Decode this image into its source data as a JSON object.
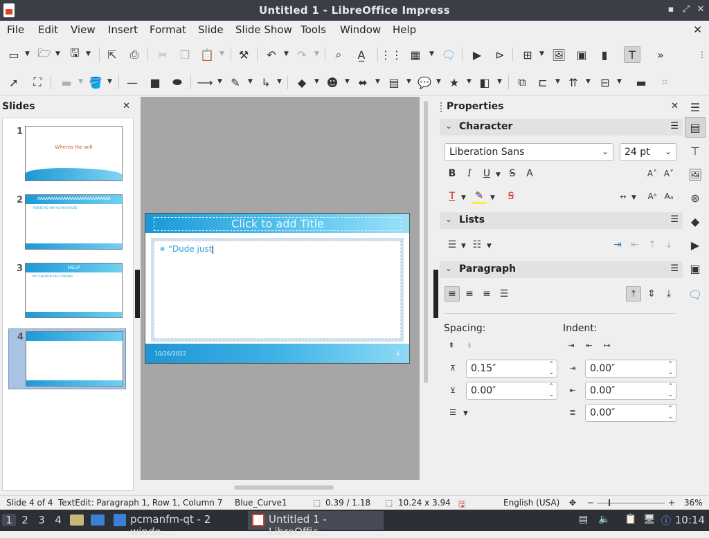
{
  "window": {
    "title": "Untitled 1 - LibreOffice Impress"
  },
  "menu": [
    "File",
    "Edit",
    "View",
    "Insert",
    "Format",
    "Slide",
    "Slide Show",
    "Tools",
    "Window",
    "Help"
  ],
  "slides_panel": {
    "title": "Slides",
    "slides": [
      {
        "num": "1",
        "title": "Wheres the wifi",
        "kind": "title"
      },
      {
        "num": "2",
        "title": "AAAAAAAAAAAAAAAAAAAAAAAAAAAA",
        "body": "THERES NO WIFI IN THIS HOUSE",
        "kind": "content"
      },
      {
        "num": "3",
        "title": "HELP",
        "body": "MY CHILDREN ARE STARVING",
        "kind": "content"
      },
      {
        "num": "4",
        "title": "",
        "body": "",
        "kind": "blank",
        "selected": true
      }
    ]
  },
  "current_slide": {
    "title_placeholder": "Click to add Title",
    "body_text": "“Dude just",
    "date": "10/26/2022",
    "page_number": "4"
  },
  "properties": {
    "title": "Properties",
    "character": {
      "label": "Character",
      "font_name": "Liberation Sans",
      "font_size": "24 pt"
    },
    "lists": {
      "label": "Lists"
    },
    "paragraph": {
      "label": "Paragraph",
      "spacing_label": "Spacing:",
      "indent_label": "Indent:",
      "above_spacing": "0.15″",
      "below_spacing": "0.00″",
      "before_indent": "0.00″",
      "after_indent": "0.00″",
      "first_line_indent": "0.00″"
    }
  },
  "status": {
    "slide": "Slide 4 of 4",
    "edit": "TextEdit: Paragraph 1, Row 1, Column 7",
    "master": "Blue_Curve1",
    "position": "0.39 / 1.18",
    "size": "10.24 x 3.94",
    "language": "English (USA)",
    "zoom": "36%"
  },
  "taskbar": {
    "workspaces": [
      "1",
      "2",
      "3",
      "4"
    ],
    "tasks": [
      {
        "label": "pcmanfm-qt - 2 windo...",
        "icon_color": "#3c7fd6"
      },
      {
        "label": "Untitled 1 - LibreOffic...",
        "icon_color": "#ffffff"
      }
    ],
    "clock": "10:14"
  }
}
